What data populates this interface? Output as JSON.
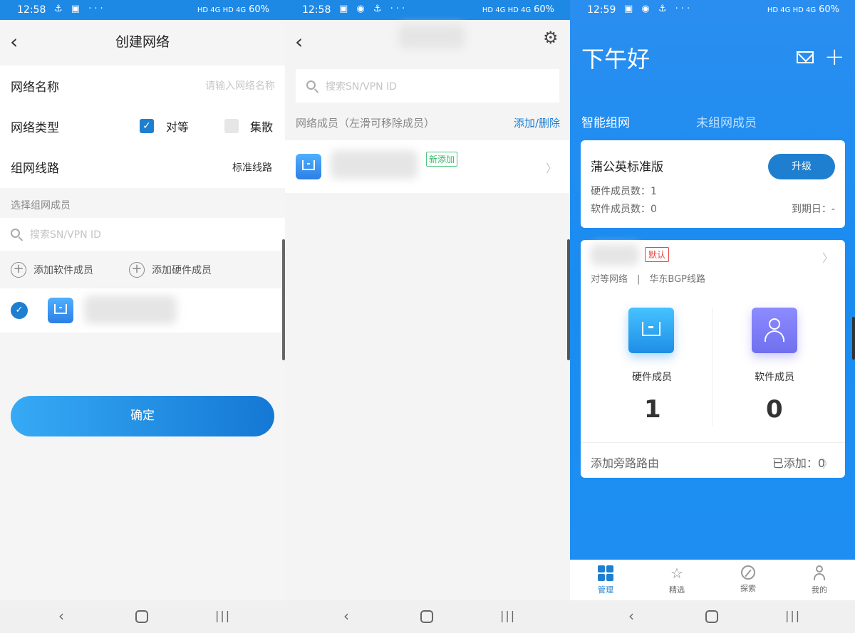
{
  "screen1": {
    "status": {
      "time": "12:58",
      "battery": "60%"
    },
    "header": {
      "back_icon": "chevron-left-icon",
      "title": "创建网络"
    },
    "form": {
      "name_label": "网络名称",
      "name_placeholder": "请输入网络名称",
      "type_label": "网络类型",
      "type_option_peer": "对等",
      "type_option_hub": "集散",
      "type_selected": "对等",
      "route_label": "组网线路",
      "route_value": "标准线路"
    },
    "member_section_label": "选择组网成员",
    "search_placeholder": "搜索SN/VPN ID",
    "add_software": "添加软件成员",
    "add_hardware": "添加硬件成员",
    "confirm_button": "确定"
  },
  "screen2": {
    "status": {
      "time": "12:58",
      "battery": "60%"
    },
    "search_placeholder": "搜索SN/VPN ID",
    "section_label": "网络成员（左滑可移除成员）",
    "add_remove_link": "添加/删除",
    "member_badge": "新添加"
  },
  "screen3": {
    "status": {
      "time": "12:59",
      "battery": "60%"
    },
    "greeting": "下午好",
    "tabs": [
      "智能组网",
      "未组网成员"
    ],
    "plan_card": {
      "title": "蒲公英标准版",
      "upgrade_button": "升级",
      "hardware_count": "硬件成员数：1",
      "software_count": "软件成员数：0",
      "expiry": "到期日：-"
    },
    "network_card": {
      "default_badge": "默认",
      "subtitle": "对等网络　|　华东BGP线路",
      "hardware_label": "硬件成员",
      "hardware_count": "1",
      "software_label": "软件成员",
      "software_count": "0",
      "bypass_label": "添加旁路路由",
      "bypass_value": "已添加：0"
    },
    "tabbar": [
      "管理",
      "精选",
      "探索",
      "我的"
    ]
  },
  "colors": {
    "accent": "#1e7fd0",
    "header_blue": "#1e88e5",
    "new_badge": "#35b76a",
    "default_badge": "#e54545"
  }
}
